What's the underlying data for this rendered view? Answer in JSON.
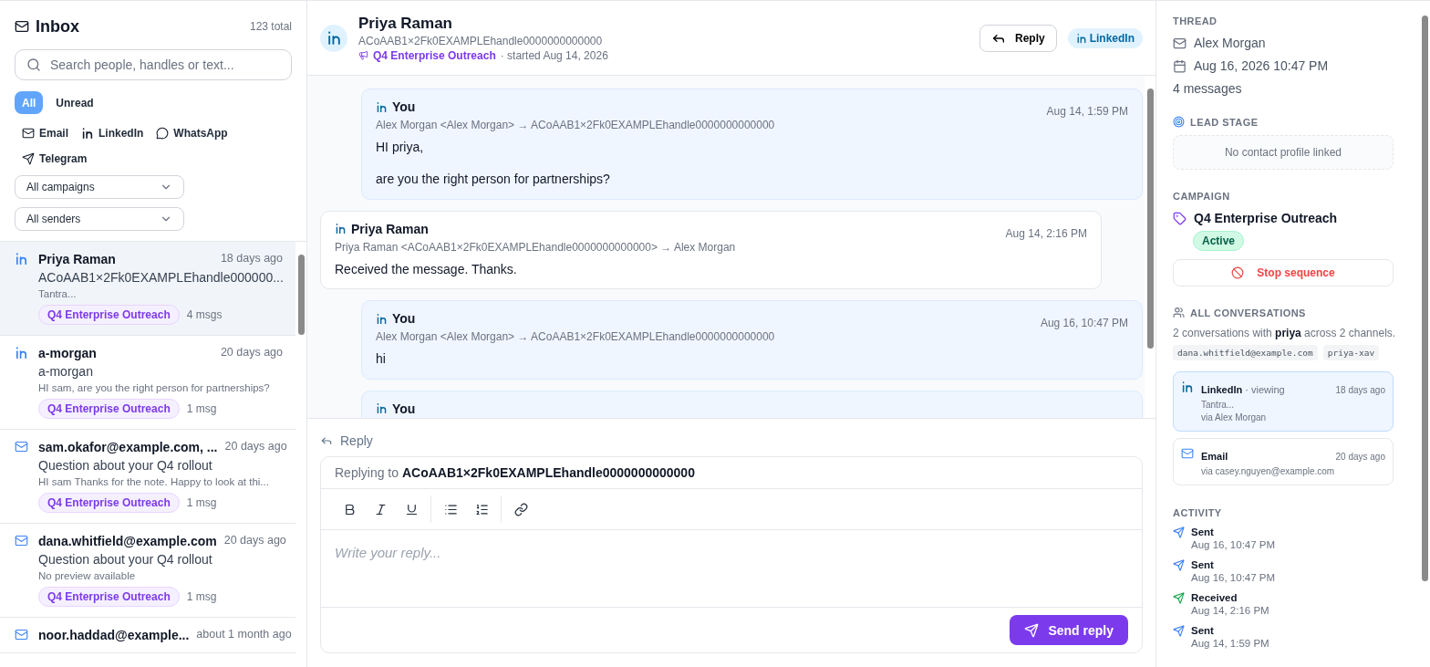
{
  "inbox": {
    "title": "Inbox",
    "total": "123 total",
    "search": {
      "placeholder": "Search people, handles or text..."
    },
    "read_filters": [
      {
        "label": "All",
        "selected": true
      },
      {
        "label": "Unread",
        "selected": false
      }
    ],
    "channel_filters": [
      {
        "kind": "email",
        "label": "Email"
      },
      {
        "kind": "linkedin",
        "label": "LinkedIn"
      },
      {
        "kind": "whatsapp",
        "label": "WhatsApp"
      },
      {
        "kind": "telegram",
        "label": "Telegram"
      }
    ],
    "dropdowns": [
      {
        "value": "All campaigns"
      },
      {
        "value": "All senders"
      }
    ],
    "conversations": [
      {
        "kind": "linkedin",
        "name": "Priya Raman",
        "time": "18 days ago",
        "subject": "ACoAAB1×2Fk0EXAMPLEhandle000000...",
        "preview": "Tantra...",
        "campaign": "Q4 Enterprise Outreach",
        "count": "4 msgs",
        "selected": true
      },
      {
        "kind": "linkedin",
        "name": "a-morgan",
        "time": "20 days ago",
        "subject": "a-morgan",
        "preview": "HI sam, are you the right person for partnerships?",
        "campaign": "Q4 Enterprise Outreach",
        "count": "1 msg",
        "selected": false
      },
      {
        "kind": "email",
        "name": "sam.okafor@example.com, ...",
        "time": "20 days ago",
        "subject": "Question about your Q4 rollout",
        "preview": "HI sam Thanks for the note. Happy to look at thi...",
        "campaign": "Q4 Enterprise Outreach",
        "count": "1 msg",
        "selected": false
      },
      {
        "kind": "email",
        "name": "dana.whitfield@example.com",
        "time": "20 days ago",
        "subject": "Question about your Q4 rollout",
        "preview": "No preview available",
        "campaign": "Q4 Enterprise Outreach",
        "count": "1 msg",
        "selected": false
      },
      {
        "kind": "email",
        "name": "noor.haddad@example...",
        "time": "about 1 month ago",
        "selected": false
      }
    ]
  },
  "thread": {
    "kind": "linkedin",
    "name": "Priya Raman",
    "handle": "ACoAAB1×2Fk0EXAMPLEhandle0000000000000",
    "campaign": "Q4 Enterprise Outreach",
    "started": "· started Aug 14, 2026",
    "reply_button": "Reply",
    "channel_badge": "LinkedIn",
    "messages": [
      {
        "kind": "outgoing",
        "sender": "You",
        "route": "Alex Morgan <Alex Morgan> → ACoAAB1×2Fk0EXAMPLEhandle0000000000000",
        "time": "Aug 14, 1:59 PM",
        "body": "HI priya,\n\nare you the right person for partnerships?"
      },
      {
        "kind": "incoming",
        "sender": "Priya Raman",
        "route": "Priya Raman <ACoAAB1×2Fk0EXAMPLEhandle0000000000000> → Alex Morgan",
        "time": "Aug 14, 2:16 PM",
        "body": "Received the message. Thanks."
      },
      {
        "kind": "outgoing",
        "sender": "You",
        "route": "Alex Morgan <Alex Morgan> → ACoAAB1×2Fk0EXAMPLEhandle0000000000000",
        "time": "Aug 16, 10:47 PM",
        "body": "hi"
      },
      {
        "kind": "outgoing",
        "sender": "You"
      }
    ]
  },
  "composer": {
    "title": "Reply",
    "replying_prefix": "Replying to",
    "replying_to": "ACoAAB1×2Fk0EXAMPLEhandle0000000000000",
    "toolbar": [
      [
        {
          "kind": "bold"
        },
        {
          "kind": "italic"
        },
        {
          "kind": "underline"
        }
      ],
      [
        {
          "kind": "bullet_list"
        },
        {
          "kind": "numbered_list"
        }
      ],
      [
        {
          "kind": "link"
        }
      ]
    ],
    "placeholder": "Write your reply...",
    "send_button": "Send reply"
  },
  "sidebar": {
    "thread": {
      "heading": "THREAD",
      "sender": "Alex Morgan",
      "date": "Aug 16, 2026 10:47 PM",
      "count": "4 messages"
    },
    "lead_stage": {
      "heading": "LEAD STAGE",
      "empty": "No contact profile linked"
    },
    "campaign": {
      "heading": "CAMPAIGN",
      "name": "Q4 Enterprise Outreach",
      "status": "Active",
      "stop_button": "Stop sequence"
    },
    "all_conversations": {
      "heading": "ALL CONVERSATIONS",
      "summary": "2 conversations with **priya** across 2 channels.",
      "handles": [
        "dana.whitfield@example.com",
        "priya-xav"
      ],
      "items": [
        {
          "kind": "linkedin",
          "channel": "LinkedIn",
          "note": "· viewing",
          "time": "18 days ago",
          "preview": "Tantra...",
          "via": "via Alex Morgan",
          "selected": true
        },
        {
          "kind": "email",
          "channel": "Email",
          "time": "20 days ago",
          "via": "via casey.nguyen@example.com",
          "selected": false
        }
      ]
    },
    "activity": {
      "heading": "ACTIVITY",
      "items": [
        {
          "kind": "sent",
          "label": "Sent",
          "time": "Aug 16, 10:47 PM"
        },
        {
          "kind": "sent",
          "label": "Sent",
          "time": "Aug 16, 10:47 PM"
        },
        {
          "kind": "received",
          "label": "Received",
          "time": "Aug 14, 2:16 PM"
        },
        {
          "kind": "sent",
          "label": "Sent",
          "time": "Aug 14, 1:59 PM"
        }
      ]
    }
  }
}
